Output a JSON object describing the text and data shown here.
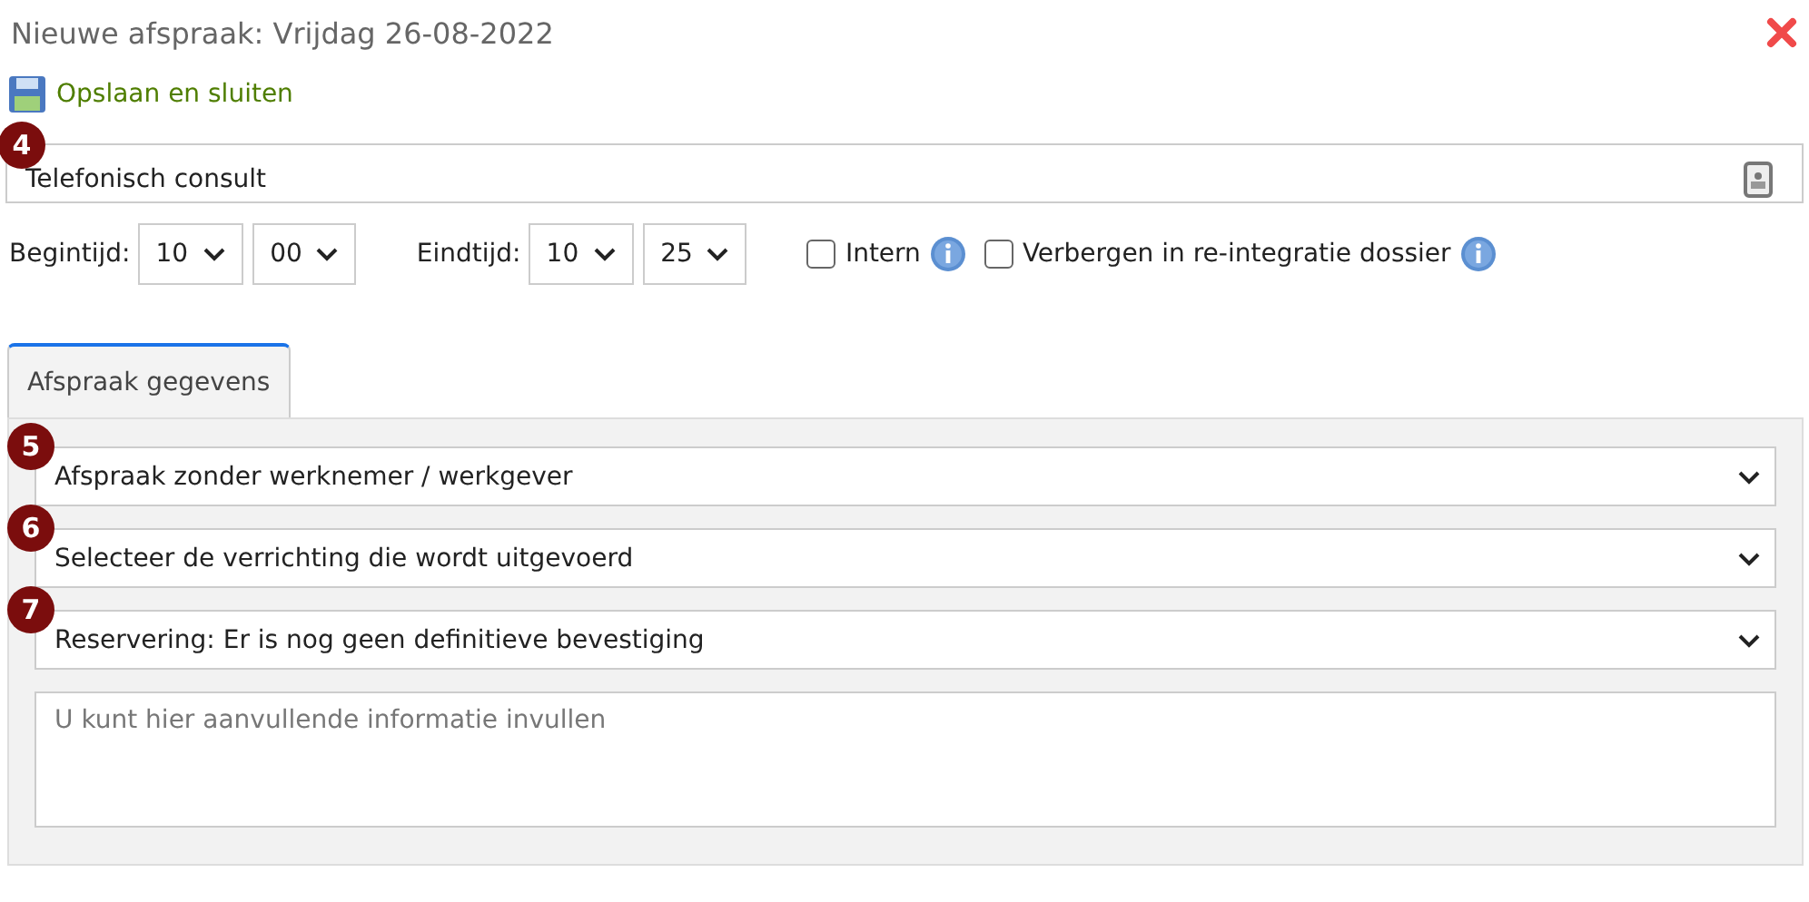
{
  "window": {
    "title": "Nieuwe afspraak: Vrijdag 26-08-2022"
  },
  "save_action": {
    "label": "Opslaan en sluiten"
  },
  "subject": {
    "badge": "4",
    "value": "Telefonisch consult"
  },
  "times": [
    {
      "label": "Begintijd:",
      "hour": "10",
      "minute": "00"
    },
    {
      "label": "Eindtijd:",
      "hour": "10",
      "minute": "25"
    }
  ],
  "checkboxes": [
    {
      "label": "Intern",
      "checked": false
    },
    {
      "label": "Verbergen in re-integratie dossier",
      "checked": false
    }
  ],
  "tabs": [
    {
      "label": "Afspraak gegevens",
      "selected": true
    }
  ],
  "selects": [
    {
      "badge": "5",
      "value": "Afspraak zonder werknemer / werkgever"
    },
    {
      "badge": "6",
      "value": "Selecteer de verrichting die wordt uitgevoerd"
    },
    {
      "badge": "7",
      "value": "Reservering: Er is nog geen definitieve bevestiging"
    }
  ],
  "notes": {
    "placeholder": "U kunt hier aanvullende informatie invullen"
  }
}
